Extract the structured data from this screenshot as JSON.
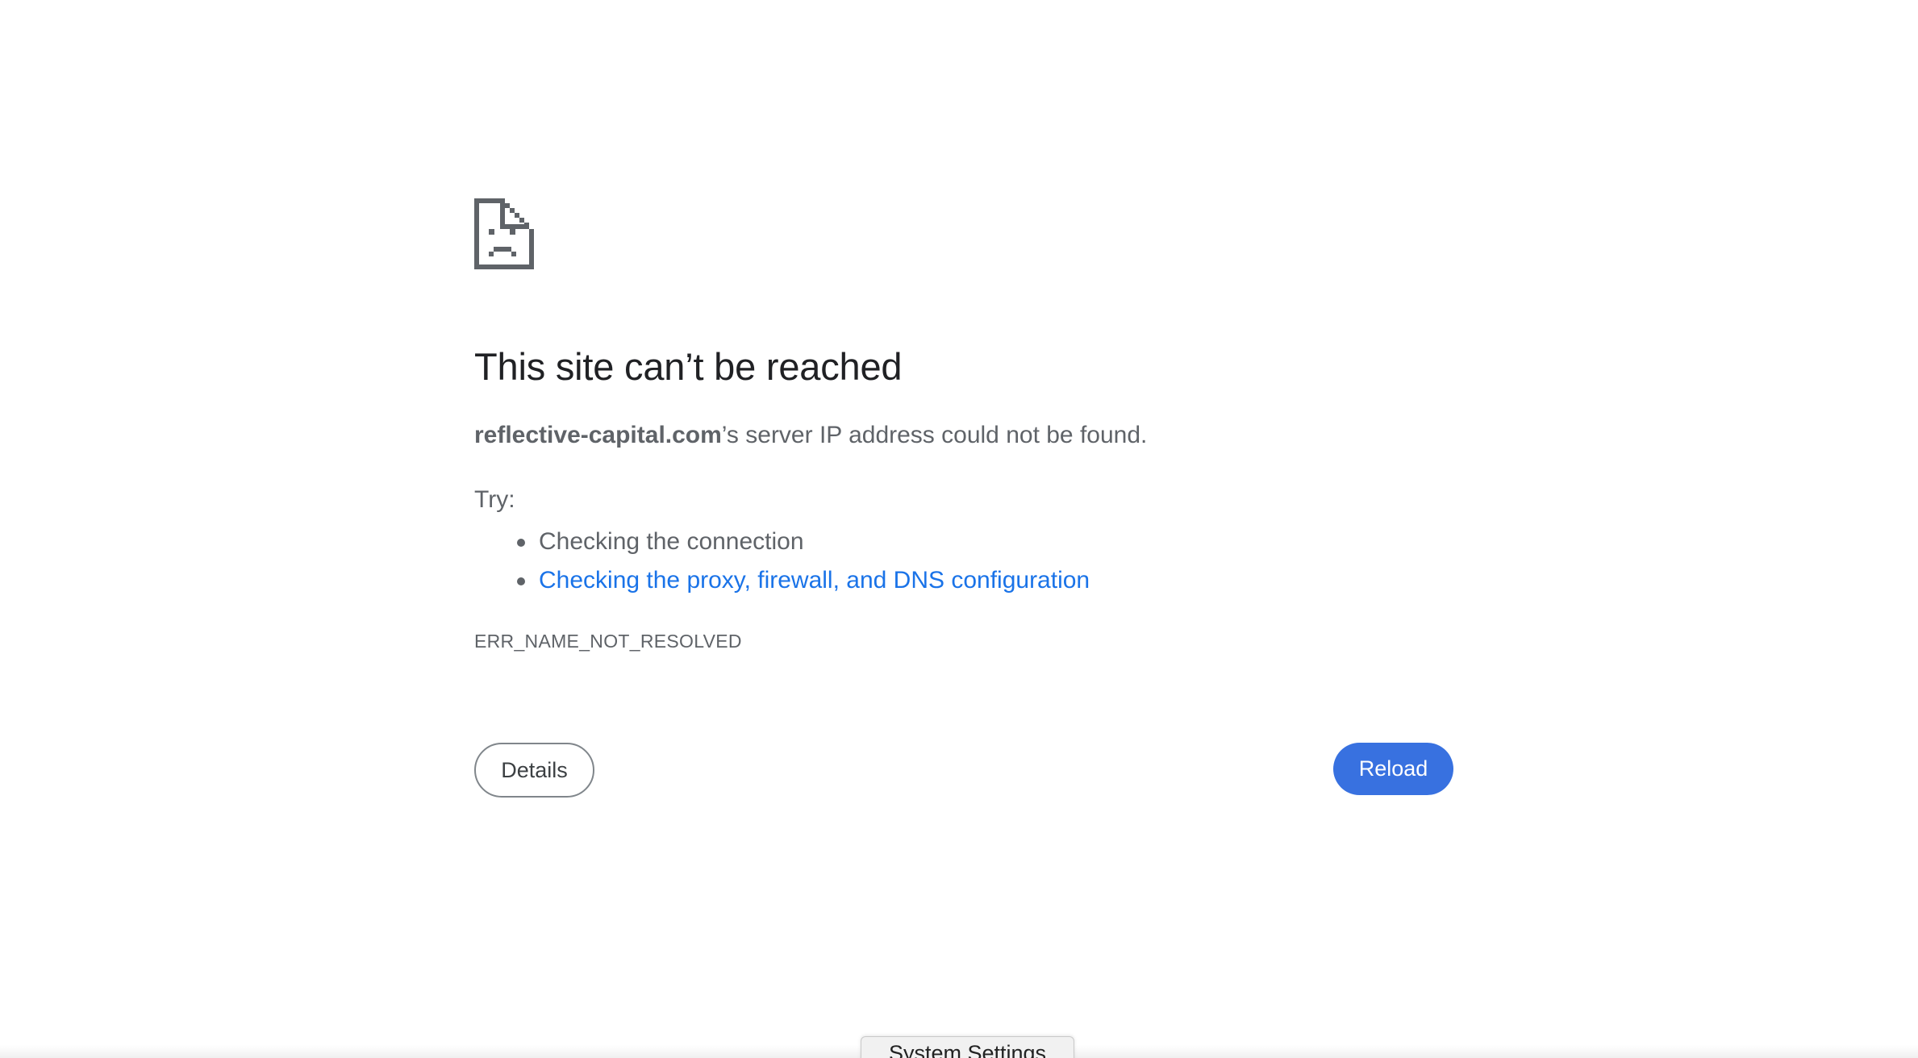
{
  "error_page": {
    "icon": "sad-document-icon",
    "title": "This site can’t be reached",
    "host": "reflective-capital.com",
    "summary_suffix": "’s server IP address could not be found.",
    "try_label": "Try:",
    "suggestions": [
      {
        "text": "Checking the connection",
        "is_link": false
      },
      {
        "text": "Checking the proxy, firewall, and DNS configuration",
        "is_link": true
      }
    ],
    "error_code": "ERR_NAME_NOT_RESOLVED",
    "details_label": "Details",
    "reload_label": "Reload"
  },
  "dock_popup": {
    "label": "System Settings"
  },
  "colors": {
    "link": "#1a73e8",
    "reload_bg": "#3871e0",
    "text": "#5f6368",
    "title": "#202124"
  }
}
